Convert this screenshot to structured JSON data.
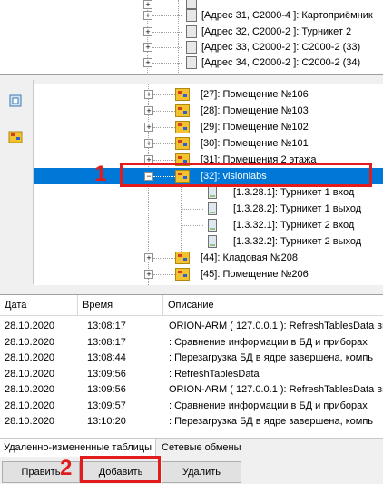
{
  "top_tree": {
    "items": [
      {
        "label": "[Адрес 31, С2000-4 ]: Картоприёмник"
      },
      {
        "label": "[Адрес 32, С2000-2 ]: Турникет 2"
      },
      {
        "label": "[Адрес 33, С2000-2 ]: С2000-2 (33)"
      },
      {
        "label": "[Адрес 34, С2000-2 ]: С2000-2 (34)"
      }
    ]
  },
  "tree": {
    "rooms_before": [
      {
        "label": "[27]: Помещение №106"
      },
      {
        "label": "[28]: Помещение №103"
      },
      {
        "label": "[29]: Помещение №102"
      },
      {
        "label": "[30]: Помещение №101"
      },
      {
        "label": "[31]: Помещения 2 этажа"
      }
    ],
    "selected": {
      "label": "[32]: visionlabs",
      "expander": "−"
    },
    "children": [
      {
        "label": "[1.3.28.1]: Турникет 1 вход"
      },
      {
        "label": "[1.3.28.2]: Турникет 1 выход"
      },
      {
        "label": "[1.3.32.1]: Турникет 2 вход"
      },
      {
        "label": "[1.3.32.2]: Турникет 2 выход"
      }
    ],
    "rooms_after": [
      {
        "label": "[44]: Кладовая №208"
      },
      {
        "label": "[45]: Помещение №206"
      }
    ],
    "expander_plus": "+"
  },
  "annotations": {
    "step1": "1",
    "step2": "2",
    "color": "#e21c1c"
  },
  "log": {
    "headers": {
      "date": "Дата",
      "time": "Время",
      "desc": "Описание"
    },
    "rows": [
      {
        "date": "28.10.2020",
        "time": "13:08:17",
        "desc": "ORION-ARM ( 127.0.0.1 ): RefreshTablesData вы"
      },
      {
        "date": "28.10.2020",
        "time": "13:08:17",
        "desc": ": Сравнение информации в БД и приборах"
      },
      {
        "date": "28.10.2020",
        "time": "13:08:44",
        "desc": ": Перезагрузка БД в ядре завершена, компь"
      },
      {
        "date": "28.10.2020",
        "time": "13:09:56",
        "desc": ": RefreshTablesData"
      },
      {
        "date": "28.10.2020",
        "time": "13:09:56",
        "desc": "ORION-ARM ( 127.0.0.1 ): RefreshTablesData вы"
      },
      {
        "date": "28.10.2020",
        "time": "13:09:57",
        "desc": ": Сравнение информации в БД и приборах"
      },
      {
        "date": "28.10.2020",
        "time": "13:10:20",
        "desc": ": Перезагрузка БД в ядре завершена, компь"
      }
    ]
  },
  "tabs": {
    "changed_tables": "Удаленно-измененные таблицы",
    "network": "Сетевые обмены"
  },
  "buttons": {
    "edit": "Править",
    "add": "Добавить",
    "delete": "Удалить"
  },
  "colors": {
    "selection": "#0078d7",
    "room_icon": "#f2c230"
  }
}
